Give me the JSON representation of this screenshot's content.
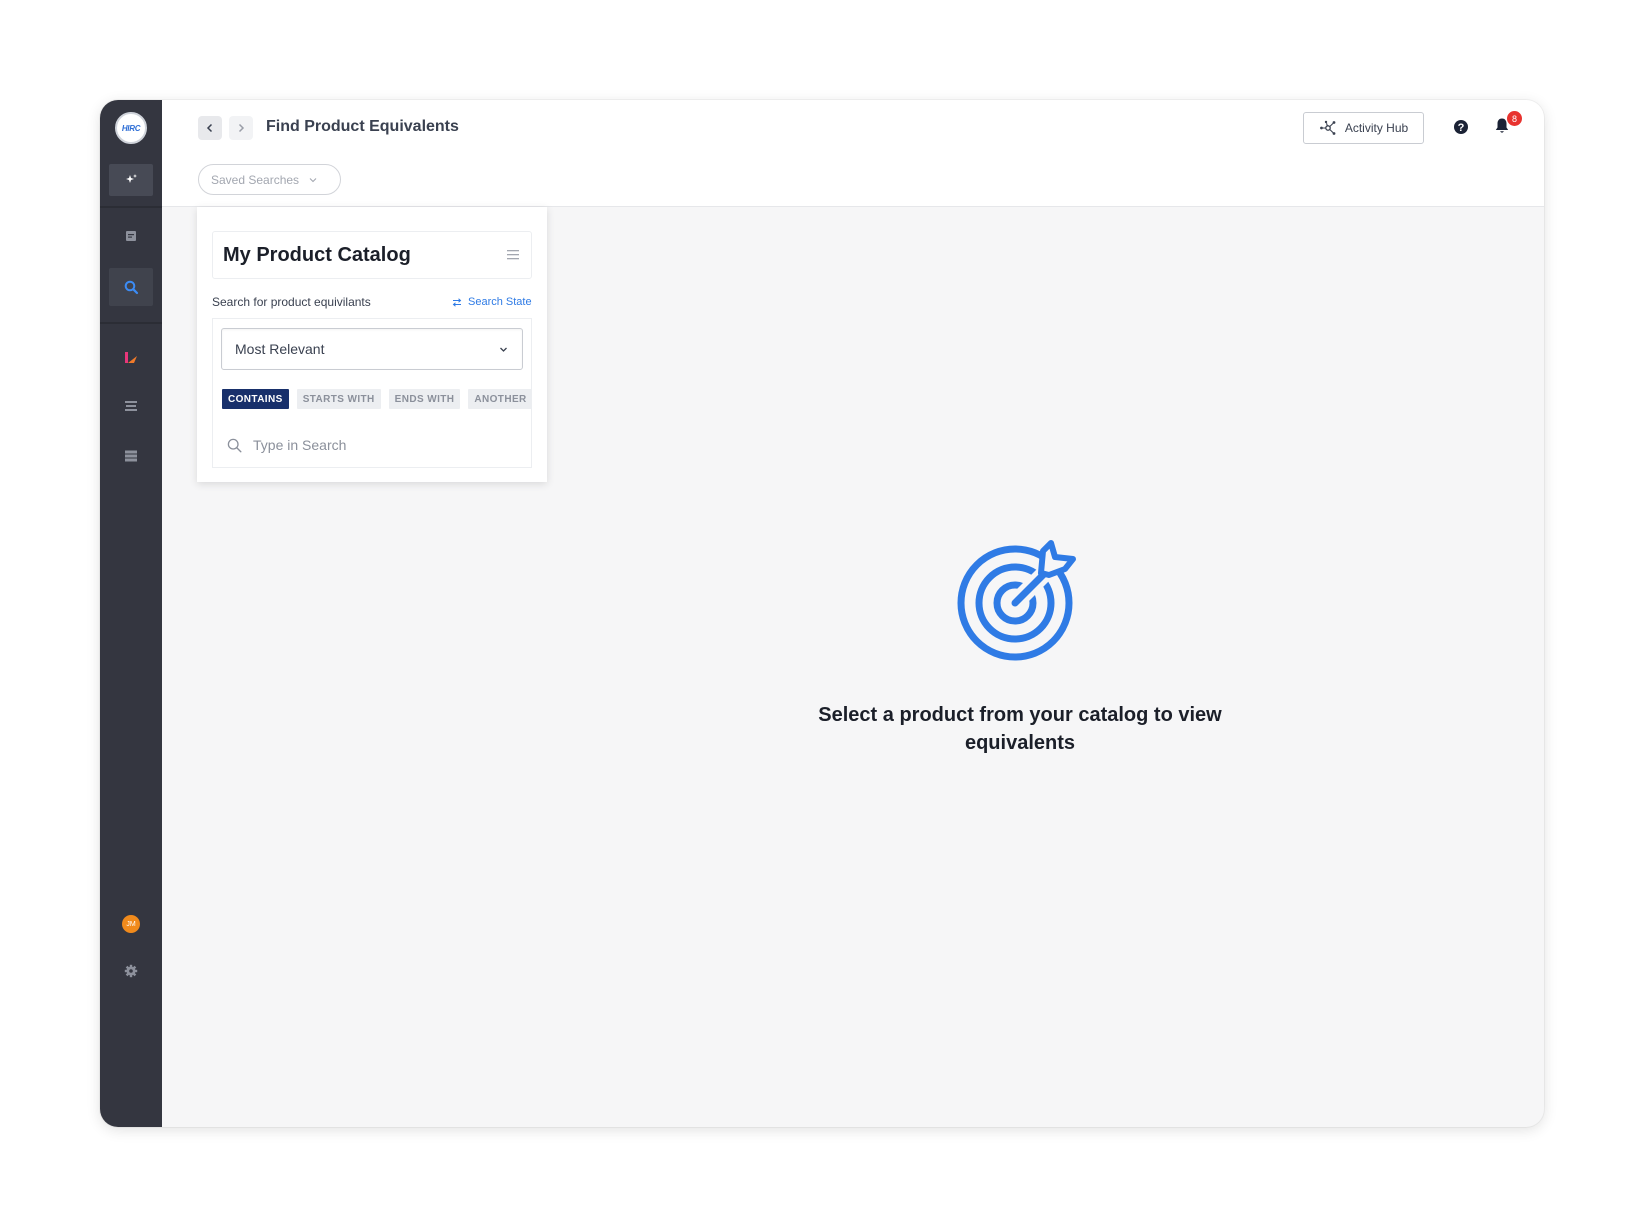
{
  "app": {
    "logo_text": "HIRC"
  },
  "header": {
    "title": "Find Product Equivalents",
    "saved_searches_label": "Saved Searches",
    "activity_hub_label": "Activity Hub",
    "notification_count": "8"
  },
  "sidebar": {
    "items": [
      {
        "icon": "sparkle-icon",
        "active": true
      },
      {
        "icon": "document-icon",
        "active": false
      },
      {
        "icon": "search-icon",
        "active": true
      },
      {
        "icon": "brand-icon",
        "active": false
      },
      {
        "icon": "list-icon",
        "active": false
      },
      {
        "icon": "database-icon",
        "active": false
      }
    ],
    "avatar_initials": "JM"
  },
  "catalog": {
    "title": "My Product Catalog",
    "search_label": "Search for product equivilants",
    "search_state_label": "Search State",
    "sort_value": "Most Relevant",
    "match_modes": [
      "CONTAINS",
      "STARTS WITH",
      "ENDS WITH",
      "ANOTHER"
    ],
    "active_match_mode": "CONTAINS",
    "search_placeholder": "Type in Search"
  },
  "empty_state": {
    "message": "Select a product from your catalog to view equivalents",
    "icon": "target-icon"
  },
  "colors": {
    "sidebar_bg": "#343640",
    "accent_blue": "#2f7be5",
    "active_chip": "#18306b",
    "badge_red": "#e8332f",
    "avatar_orange": "#f08a1c"
  }
}
